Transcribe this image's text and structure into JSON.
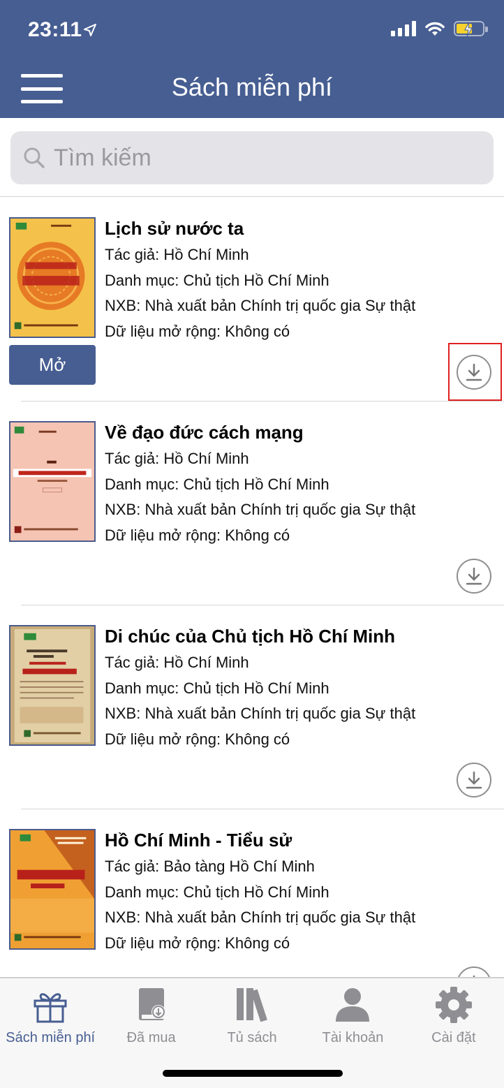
{
  "status_bar": {
    "time": "23:11"
  },
  "header": {
    "title": "Sách miễn phí"
  },
  "search": {
    "placeholder": "Tìm kiếm"
  },
  "books": [
    {
      "title": "Lịch sử nước ta",
      "author": "Tác giả: Hồ Chí Minh",
      "category": "Danh mục: Chủ tịch Hồ Chí Minh",
      "publisher": "NXB: Nhà xuất bản Chính trị quốc gia Sự thật",
      "extra": "Dữ liệu mở rộng: Không có",
      "open_label": "Mở"
    },
    {
      "title": "Về đạo đức cách mạng",
      "author": "Tác giả: Hồ Chí Minh",
      "category": "Danh mục: Chủ tịch Hồ Chí Minh",
      "publisher": "NXB: Nhà xuất bản Chính trị quốc gia Sự thật",
      "extra": "Dữ liệu mở rộng: Không có"
    },
    {
      "title": "Di chúc của Chủ tịch Hồ Chí Minh",
      "author": "Tác giả: Hồ Chí Minh",
      "category": "Danh mục: Chủ tịch Hồ Chí Minh",
      "publisher": "NXB: Nhà xuất bản Chính trị quốc gia Sự thật",
      "extra": "Dữ liệu mở rộng: Không có"
    },
    {
      "title": "Hồ Chí Minh - Tiểu sử",
      "author": "Tác giả: Bảo tàng Hồ Chí Minh",
      "category": "Danh mục: Chủ tịch Hồ Chí Minh",
      "publisher": "NXB: Nhà xuất bản Chính trị quốc gia Sự thật",
      "extra": "Dữ liệu mở rộng: Không có"
    }
  ],
  "tabs": [
    {
      "label": "Sách miễn phí",
      "icon": "gift-icon",
      "active": true
    },
    {
      "label": "Đã mua",
      "icon": "purchased-book-icon",
      "active": false
    },
    {
      "label": "Tủ sách",
      "icon": "bookshelf-icon",
      "active": false
    },
    {
      "label": "Tài khoản",
      "icon": "user-icon",
      "active": false
    },
    {
      "label": "Cài đặt",
      "icon": "gear-icon",
      "active": false
    }
  ],
  "colors": {
    "primary": "#475e92",
    "tab_inactive": "#8e8e93",
    "highlight": "#e02020"
  }
}
